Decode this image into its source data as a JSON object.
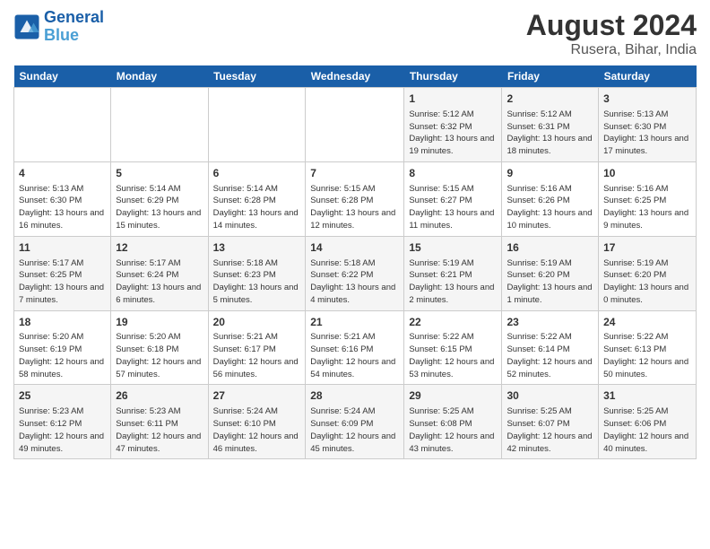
{
  "logo": {
    "line1": "General",
    "line2": "Blue"
  },
  "title": "August 2024",
  "location": "Rusera, Bihar, India",
  "days_of_week": [
    "Sunday",
    "Monday",
    "Tuesday",
    "Wednesday",
    "Thursday",
    "Friday",
    "Saturday"
  ],
  "weeks": [
    [
      {
        "day": "",
        "content": ""
      },
      {
        "day": "",
        "content": ""
      },
      {
        "day": "",
        "content": ""
      },
      {
        "day": "",
        "content": ""
      },
      {
        "day": "1",
        "content": "Sunrise: 5:12 AM\nSunset: 6:32 PM\nDaylight: 13 hours\nand 19 minutes."
      },
      {
        "day": "2",
        "content": "Sunrise: 5:12 AM\nSunset: 6:31 PM\nDaylight: 13 hours\nand 18 minutes."
      },
      {
        "day": "3",
        "content": "Sunrise: 5:13 AM\nSunset: 6:30 PM\nDaylight: 13 hours\nand 17 minutes."
      }
    ],
    [
      {
        "day": "4",
        "content": "Sunrise: 5:13 AM\nSunset: 6:30 PM\nDaylight: 13 hours\nand 16 minutes."
      },
      {
        "day": "5",
        "content": "Sunrise: 5:14 AM\nSunset: 6:29 PM\nDaylight: 13 hours\nand 15 minutes."
      },
      {
        "day": "6",
        "content": "Sunrise: 5:14 AM\nSunset: 6:28 PM\nDaylight: 13 hours\nand 14 minutes."
      },
      {
        "day": "7",
        "content": "Sunrise: 5:15 AM\nSunset: 6:28 PM\nDaylight: 13 hours\nand 12 minutes."
      },
      {
        "day": "8",
        "content": "Sunrise: 5:15 AM\nSunset: 6:27 PM\nDaylight: 13 hours\nand 11 minutes."
      },
      {
        "day": "9",
        "content": "Sunrise: 5:16 AM\nSunset: 6:26 PM\nDaylight: 13 hours\nand 10 minutes."
      },
      {
        "day": "10",
        "content": "Sunrise: 5:16 AM\nSunset: 6:25 PM\nDaylight: 13 hours\nand 9 minutes."
      }
    ],
    [
      {
        "day": "11",
        "content": "Sunrise: 5:17 AM\nSunset: 6:25 PM\nDaylight: 13 hours\nand 7 minutes."
      },
      {
        "day": "12",
        "content": "Sunrise: 5:17 AM\nSunset: 6:24 PM\nDaylight: 13 hours\nand 6 minutes."
      },
      {
        "day": "13",
        "content": "Sunrise: 5:18 AM\nSunset: 6:23 PM\nDaylight: 13 hours\nand 5 minutes."
      },
      {
        "day": "14",
        "content": "Sunrise: 5:18 AM\nSunset: 6:22 PM\nDaylight: 13 hours\nand 4 minutes."
      },
      {
        "day": "15",
        "content": "Sunrise: 5:19 AM\nSunset: 6:21 PM\nDaylight: 13 hours\nand 2 minutes."
      },
      {
        "day": "16",
        "content": "Sunrise: 5:19 AM\nSunset: 6:20 PM\nDaylight: 13 hours\nand 1 minute."
      },
      {
        "day": "17",
        "content": "Sunrise: 5:19 AM\nSunset: 6:20 PM\nDaylight: 13 hours\nand 0 minutes."
      }
    ],
    [
      {
        "day": "18",
        "content": "Sunrise: 5:20 AM\nSunset: 6:19 PM\nDaylight: 12 hours\nand 58 minutes."
      },
      {
        "day": "19",
        "content": "Sunrise: 5:20 AM\nSunset: 6:18 PM\nDaylight: 12 hours\nand 57 minutes."
      },
      {
        "day": "20",
        "content": "Sunrise: 5:21 AM\nSunset: 6:17 PM\nDaylight: 12 hours\nand 56 minutes."
      },
      {
        "day": "21",
        "content": "Sunrise: 5:21 AM\nSunset: 6:16 PM\nDaylight: 12 hours\nand 54 minutes."
      },
      {
        "day": "22",
        "content": "Sunrise: 5:22 AM\nSunset: 6:15 PM\nDaylight: 12 hours\nand 53 minutes."
      },
      {
        "day": "23",
        "content": "Sunrise: 5:22 AM\nSunset: 6:14 PM\nDaylight: 12 hours\nand 52 minutes."
      },
      {
        "day": "24",
        "content": "Sunrise: 5:22 AM\nSunset: 6:13 PM\nDaylight: 12 hours\nand 50 minutes."
      }
    ],
    [
      {
        "day": "25",
        "content": "Sunrise: 5:23 AM\nSunset: 6:12 PM\nDaylight: 12 hours\nand 49 minutes."
      },
      {
        "day": "26",
        "content": "Sunrise: 5:23 AM\nSunset: 6:11 PM\nDaylight: 12 hours\nand 47 minutes."
      },
      {
        "day": "27",
        "content": "Sunrise: 5:24 AM\nSunset: 6:10 PM\nDaylight: 12 hours\nand 46 minutes."
      },
      {
        "day": "28",
        "content": "Sunrise: 5:24 AM\nSunset: 6:09 PM\nDaylight: 12 hours\nand 45 minutes."
      },
      {
        "day": "29",
        "content": "Sunrise: 5:25 AM\nSunset: 6:08 PM\nDaylight: 12 hours\nand 43 minutes."
      },
      {
        "day": "30",
        "content": "Sunrise: 5:25 AM\nSunset: 6:07 PM\nDaylight: 12 hours\nand 42 minutes."
      },
      {
        "day": "31",
        "content": "Sunrise: 5:25 AM\nSunset: 6:06 PM\nDaylight: 12 hours\nand 40 minutes."
      }
    ]
  ]
}
